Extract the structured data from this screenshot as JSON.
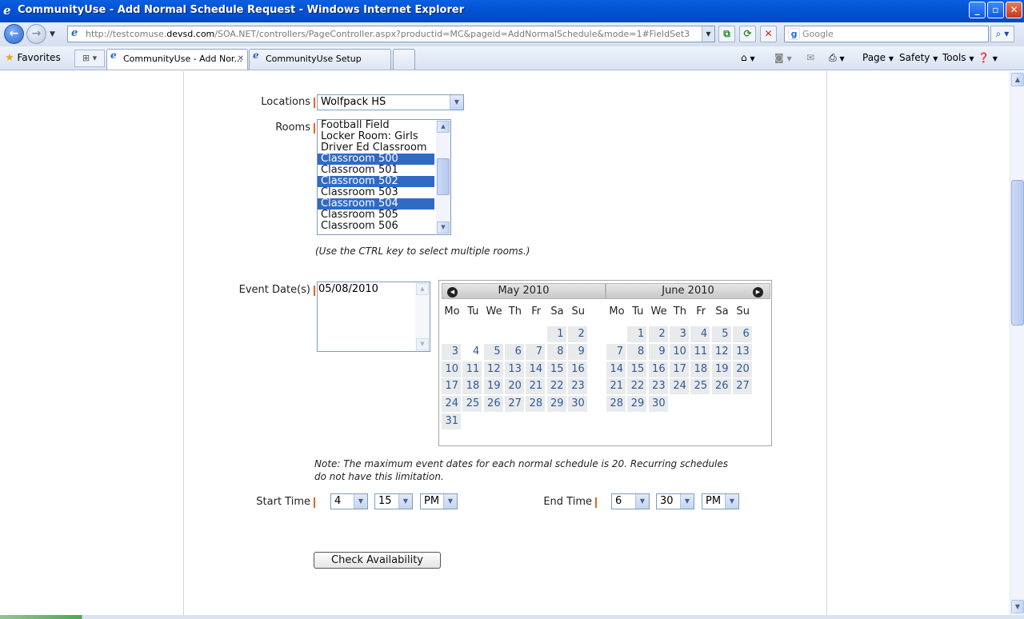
{
  "window": {
    "title": "CommunityUse - Add Normal Schedule Request - Windows Internet Explorer",
    "btn_min": "_",
    "btn_max": "▫",
    "btn_close": "✕"
  },
  "address": {
    "url_prefix": "http://testcomuse.",
    "url_domain": "devsd.com",
    "url_rest": "/SOA.NET/controllers/PageController.aspx?productid=MC&pageid=AddNormalSchedule&mode=1#FieldSet3",
    "search_placeholder": "Google"
  },
  "favorites": {
    "label": "Favorites",
    "tabs": [
      {
        "label": "CommunityUse - Add Nor..."
      },
      {
        "label": "CommunityUse Setup"
      }
    ],
    "commands": {
      "page": "Page",
      "safety": "Safety",
      "tools": "Tools"
    }
  },
  "form": {
    "locations_label": "Locations",
    "location_value": "Wolfpack HS",
    "rooms_label": "Rooms",
    "rooms": [
      {
        "name": "Football Field",
        "selected": false
      },
      {
        "name": "Locker Room: Girls",
        "selected": false
      },
      {
        "name": "Driver Ed Classroom",
        "selected": false
      },
      {
        "name": "Classroom 500",
        "selected": true
      },
      {
        "name": "Classroom 501",
        "selected": false
      },
      {
        "name": "Classroom 502",
        "selected": true
      },
      {
        "name": "Classroom 503",
        "selected": false
      },
      {
        "name": "Classroom 504",
        "selected": true
      },
      {
        "name": "Classroom 505",
        "selected": false
      },
      {
        "name": "Classroom 506",
        "selected": false
      }
    ],
    "rooms_hint": "(Use the CTRL key to select multiple rooms.)",
    "event_dates_label": "Event Date(s)",
    "event_dates_value": "05/08/2010",
    "note_line1": "Note: The maximum event dates for each normal schedule is 20. Recurring schedules",
    "note_line2": "do not have this limitation.",
    "start_time_label": "Start Time",
    "start_hour": "4",
    "start_minute": "15",
    "start_ampm": "PM",
    "end_time_label": "End Time",
    "end_hour": "6",
    "end_minute": "30",
    "end_ampm": "PM",
    "check_button": "Check Availability"
  },
  "calendar": {
    "days_of_week": [
      "Mo",
      "Tu",
      "We",
      "Th",
      "Fr",
      "Sa",
      "Su"
    ],
    "months": [
      {
        "title": "May 2010",
        "first_weekday": 5,
        "days": 31
      },
      {
        "title": "June  2010",
        "first_weekday": 1,
        "days": 30
      }
    ]
  }
}
